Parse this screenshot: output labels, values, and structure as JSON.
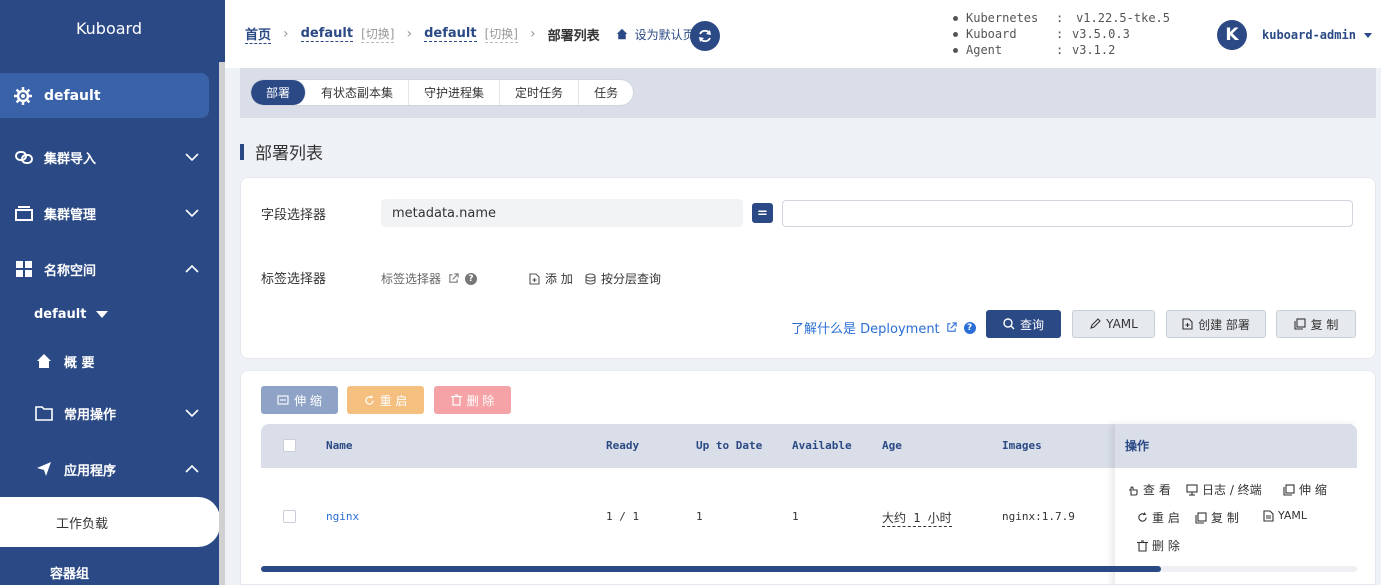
{
  "sidebar": {
    "logo": "Kuboard",
    "cluster": "default",
    "items": [
      {
        "label": "集群导入"
      },
      {
        "label": "集群管理"
      },
      {
        "label": "名称空间"
      }
    ],
    "namespace": "default",
    "overview": "概 要",
    "common_ops": "常用操作",
    "apps": "应用程序",
    "workload": "工作负载",
    "pods": "容器组"
  },
  "header": {
    "home": "首页",
    "cluster": "default",
    "switch1": "[切换]",
    "namespace": "default",
    "switch2": "[切换]",
    "current": "部署列表",
    "set_default": "设为默认页",
    "versions": [
      {
        "name": "Kubernetes",
        "colon": ":",
        "value": "v1.22.5-tke.5"
      },
      {
        "name": "Kuboard",
        "colon": ":",
        "value": "v3.5.0.3"
      },
      {
        "name": "Agent",
        "colon": ":",
        "value": "v3.1.2"
      }
    ],
    "avatar_letter": "K",
    "username": "kuboard-admin"
  },
  "tabs": [
    "部署",
    "有状态副本集",
    "守护进程集",
    "定时任务",
    "任务"
  ],
  "page_title": "部署列表",
  "filter": {
    "field_selector_label": "字段选择器",
    "field_selector_value": "metadata.name",
    "eq": "=",
    "field_input_value": "",
    "label_selector_label": "标签选择器",
    "label_selector_link": "标签选择器",
    "add": "添 加",
    "hierarchical": "按分层查询",
    "learn": "了解什么是 Deployment",
    "query": "查询",
    "yaml": "YAML",
    "create": "创建 部署",
    "copy": "复 制"
  },
  "table_actions": {
    "scale": "伸 缩",
    "restart": "重 启",
    "delete": "删 除"
  },
  "table": {
    "columns": [
      "Name",
      "Ready",
      "Up to Date",
      "Available",
      "Age",
      "Images"
    ],
    "ops_header": "操作",
    "rows": [
      {
        "name": "nginx",
        "ready": "1 / 1",
        "up_to_date": "1",
        "available": "1",
        "age": "大约 1 小时",
        "images": "nginx:1.7.9"
      }
    ],
    "row_ops": {
      "view": "查 看",
      "logs": "日志 / 终端",
      "scale": "伸 缩",
      "restart": "重 启",
      "copy": "复 制",
      "yaml": "YAML",
      "delete": "删 除"
    }
  },
  "colors": {
    "primary": "#2b4a85",
    "scale_btn": "#8fa3c7",
    "restart_btn": "#f5bf80",
    "delete_btn": "#f5a3a6"
  }
}
